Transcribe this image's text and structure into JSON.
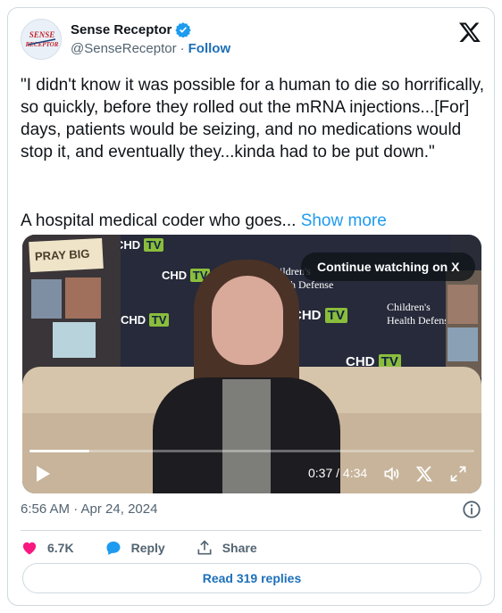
{
  "author": {
    "name": "Sense Receptor",
    "handle": "@SenseReceptor",
    "separator": "·",
    "follow_label": "Follow",
    "avatar_text_1": "SENSE",
    "avatar_text_2": "RECEPTOR"
  },
  "tweet": {
    "text": "\"I didn't know it was possible for a human to die so horrifically, so quickly, before they rolled out the mRNA injections...[For] days, patients would be seizing, and no medications would stop it, and eventually they...kinda had to be put down.\"",
    "second_line": "A hospital medical coder who goes...",
    "show_more_label": "Show more"
  },
  "video": {
    "continue_label": "Continue watching on X",
    "elapsed": "0:37",
    "duration": "4:34",
    "time_display": "0:37 / 4:34",
    "progress_fraction": 0.135,
    "background_text": {
      "pray": "PRAY BIG",
      "chd": "CHD",
      "tv": "TV",
      "childrens": "Children's",
      "health_defense": "Health Defense"
    }
  },
  "meta": {
    "timestamp": "6:56 AM · Apr 24, 2024"
  },
  "actions": {
    "likes": "6.7K",
    "reply_label": "Reply",
    "share_label": "Share",
    "read_replies_label": "Read 319 replies"
  },
  "colors": {
    "accent": "#1d9bf0",
    "link": "#1d6fb8",
    "like": "#f91880",
    "muted": "#536471"
  },
  "icons": [
    "verified-badge-icon",
    "x-logo-icon",
    "play-icon",
    "volume-icon",
    "x-small-icon",
    "fullscreen-icon",
    "info-icon",
    "heart-icon",
    "reply-bubble-icon",
    "share-icon"
  ]
}
